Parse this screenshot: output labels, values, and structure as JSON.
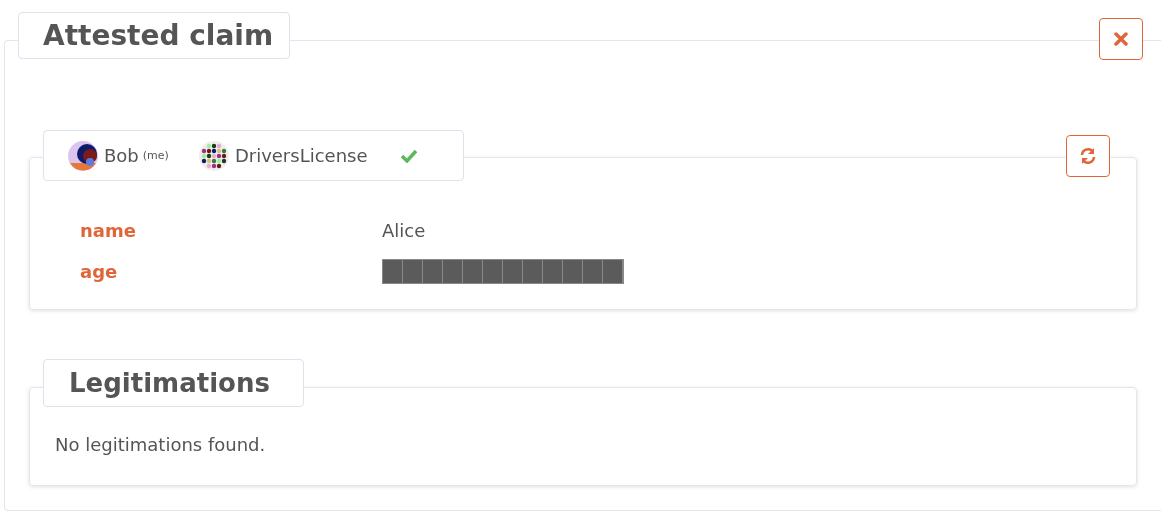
{
  "title": "Attested claim",
  "claim": {
    "owner": {
      "name": "Bob",
      "note": "(me)"
    },
    "ctype": {
      "name": "DriversLicense"
    },
    "verified": true,
    "fields": [
      {
        "label": "name",
        "value": "Alice",
        "redacted": false
      },
      {
        "label": "age",
        "redacted": true
      }
    ]
  },
  "legitimations": {
    "title": "Legitimations",
    "empty_text": "No legitimations found."
  }
}
